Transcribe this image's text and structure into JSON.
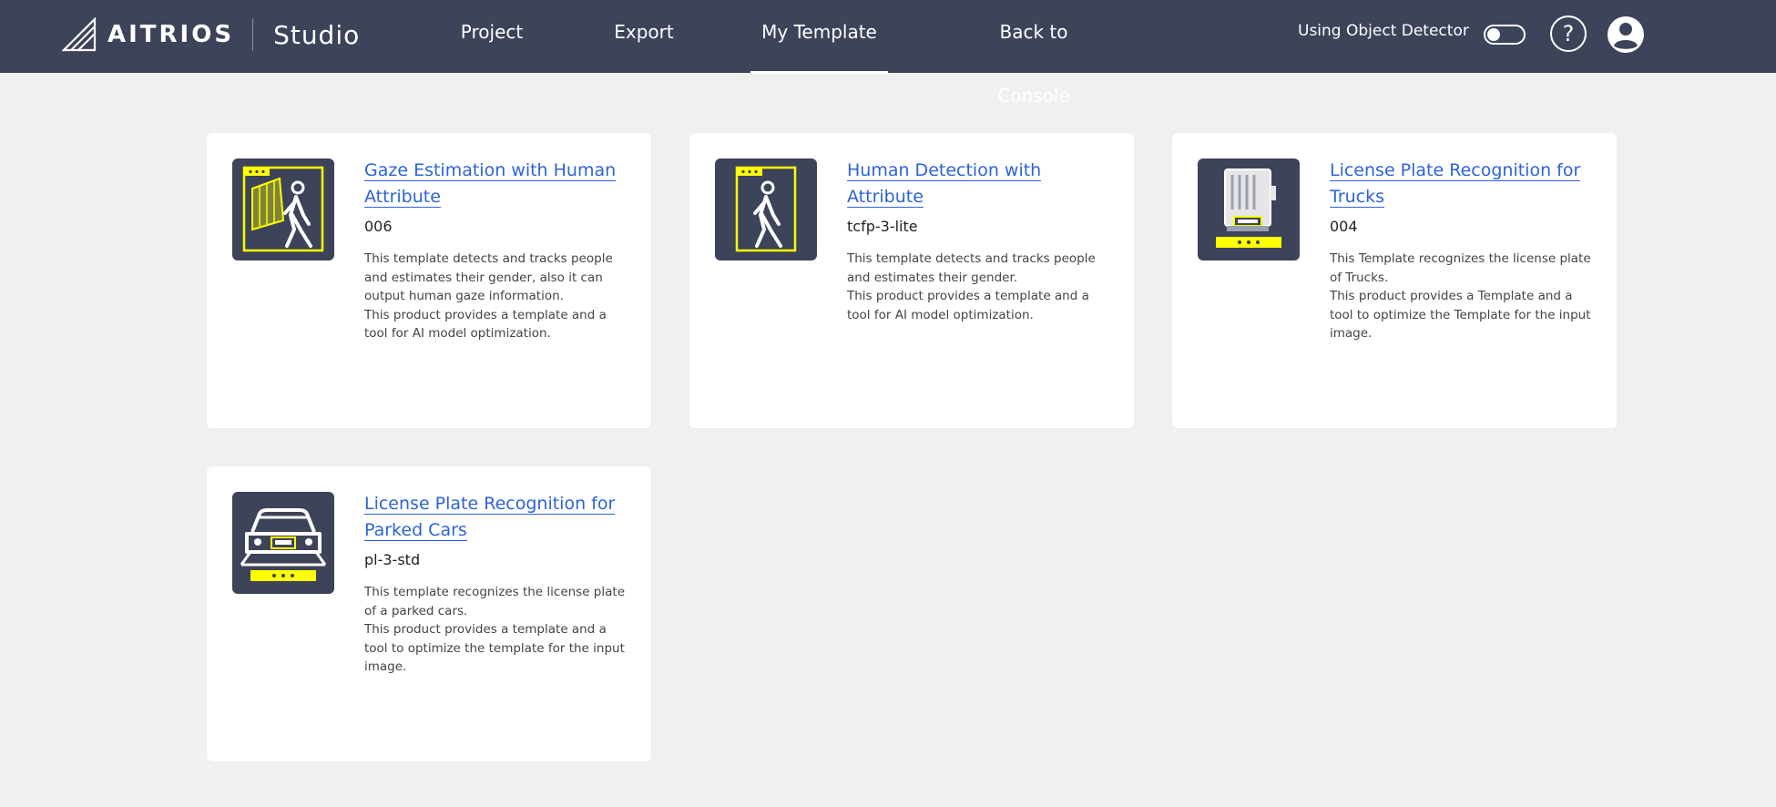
{
  "header": {
    "brand": "AITRIOS",
    "product": "Studio",
    "nav": [
      {
        "label": "Project"
      },
      {
        "label": "Export"
      },
      {
        "label": "My Template"
      },
      {
        "label": "Back to Console"
      }
    ],
    "using_label": "Using Object Detector",
    "help_label": "?",
    "colors": {
      "bar": "#3d4359",
      "accent": "#ffff00",
      "link": "#2d63d8"
    }
  },
  "templates": [
    {
      "title": "Gaze Estimation with Human Attribute",
      "id": "006",
      "description": "This template detects and tracks people and estimates their gender, also it can output human gaze information.\nThis product provides a template and a tool for AI model optimization.",
      "icon": "gaze-person-icon"
    },
    {
      "title": "Human Detection with Attribute",
      "id": "tcfp-3-lite",
      "description": "This template detects and tracks people and estimates their gender.\nThis product provides a template and a tool for AI model optimization.",
      "icon": "person-walking-icon"
    },
    {
      "title": "License Plate Recognition for Trucks",
      "id": "004",
      "description": "This Template recognizes the license plate of Trucks.\nThis product provides a Template and a tool to optimize the Template for the input image.",
      "icon": "truck-plate-icon"
    },
    {
      "title": "License Plate Recognition for Parked Cars",
      "id": "pl-3-std",
      "description": "This template recognizes the license plate of a parked cars.\nThis product provides a template and a tool to optimize the template for the input image.",
      "icon": "car-plate-icon"
    }
  ]
}
